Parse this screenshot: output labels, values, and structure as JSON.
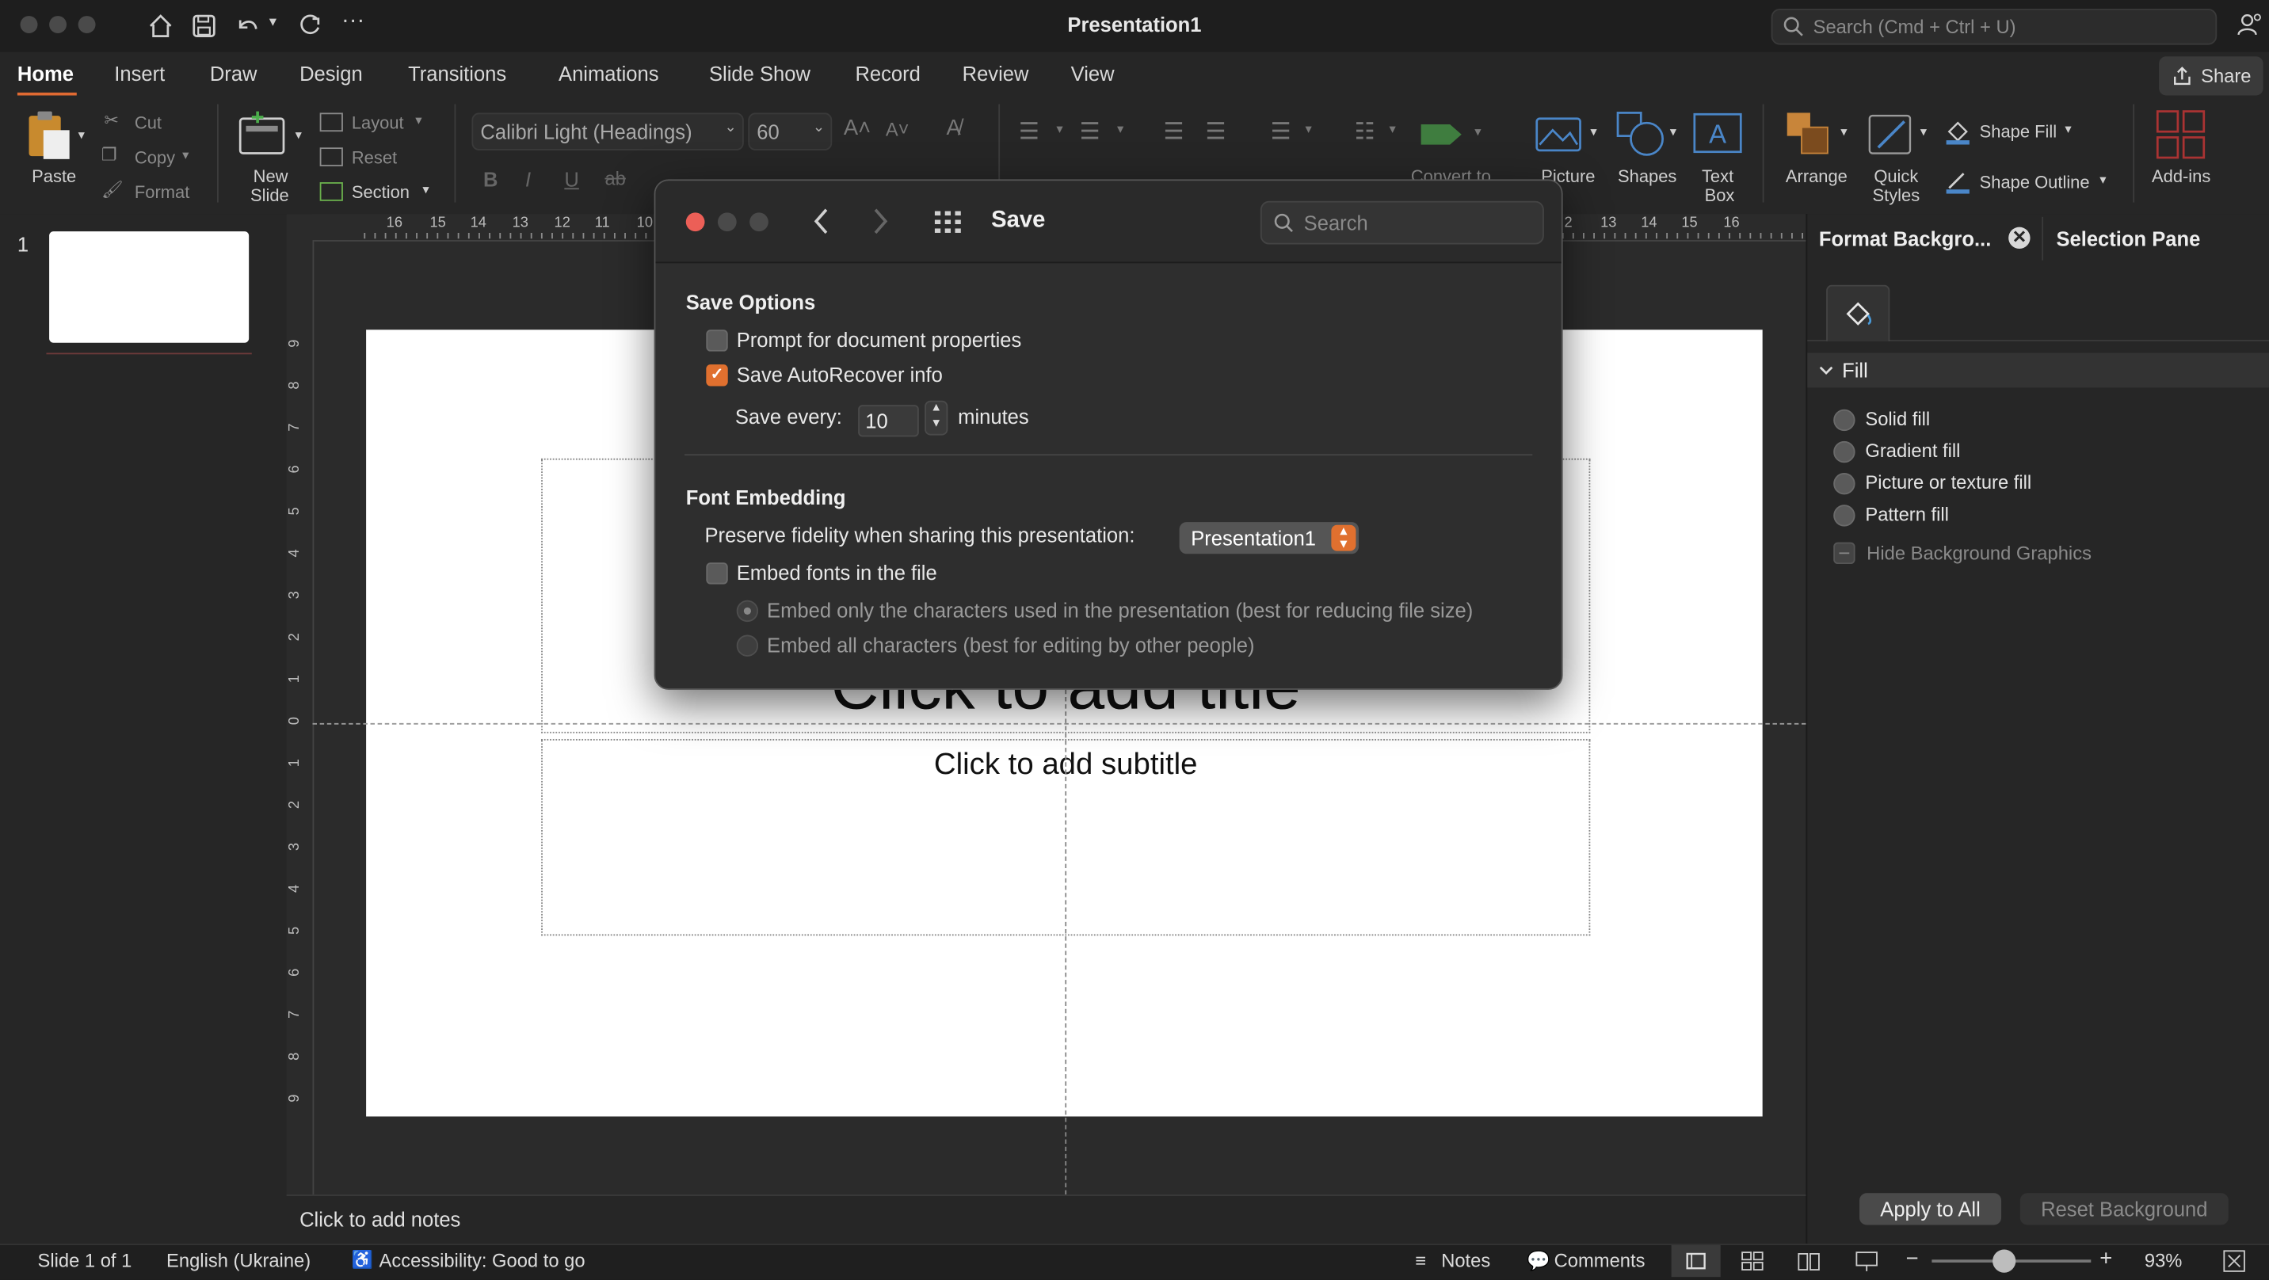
{
  "window": {
    "title": "Presentation1",
    "search_placeholder": "Search (Cmd + Ctrl + U)"
  },
  "tabs": [
    "Home",
    "Insert",
    "Draw",
    "Design",
    "Transitions",
    "Animations",
    "Slide Show",
    "Record",
    "Review",
    "View"
  ],
  "share_label": "Share",
  "ribbon": {
    "paste": "Paste",
    "cut": "Cut",
    "copy": "Copy",
    "format": "Format",
    "new_slide": "New\nSlide",
    "new_slide_l1": "New",
    "new_slide_l2": "Slide",
    "layout": "Layout",
    "reset": "Reset",
    "section": "Section",
    "font_name": "Calibri Light (Headings)",
    "font_size": "60",
    "convert_to": "Convert to",
    "picture": "Picture",
    "shapes": "Shapes",
    "text_box_l1": "Text",
    "text_box_l2": "Box",
    "arrange": "Arrange",
    "quick_styles_l1": "Quick",
    "quick_styles_l2": "Styles",
    "shape_fill": "Shape Fill",
    "shape_outline": "Shape Outline",
    "add_ins": "Add-ins"
  },
  "ruler_labels": [
    "16",
    "15",
    "14",
    "13",
    "12",
    "11",
    "10",
    "2",
    "13",
    "14",
    "15",
    "16"
  ],
  "vruler_labels": [
    "9",
    "8",
    "7",
    "6",
    "5",
    "4",
    "3",
    "2",
    "1",
    "0",
    "1",
    "2",
    "3",
    "4",
    "5",
    "6",
    "7",
    "8",
    "9"
  ],
  "thumbnails": {
    "slide_number": "1"
  },
  "slide": {
    "title_placeholder": "Click to add title",
    "subtitle_placeholder": "Click to add subtitle"
  },
  "notes_placeholder": "Click to add notes",
  "format_pane": {
    "tab_format": "Format Backgro...",
    "tab_selection": "Selection Pane",
    "section": "Fill",
    "options": [
      "Solid fill",
      "Gradient fill",
      "Picture or texture fill",
      "Pattern fill"
    ],
    "hide_bg": "Hide Background Graphics",
    "apply_all": "Apply to All",
    "reset_bg": "Reset Background"
  },
  "dialog": {
    "title": "Save",
    "search_placeholder": "Search",
    "save_options_heading": "Save Options",
    "prompt_props": "Prompt for document properties",
    "prompt_props_checked": false,
    "autorecover": "Save AutoRecover info",
    "autorecover_checked": true,
    "save_every_label": "Save every:",
    "save_every_value": "10",
    "minutes_label": "minutes",
    "font_embedding_heading": "Font Embedding",
    "preserve_label": "Preserve fidelity when sharing this presentation:",
    "preserve_value": "Presentation1",
    "embed_fonts": "Embed fonts in the file",
    "embed_fonts_checked": false,
    "embed_only": "Embed only the characters used in the presentation (best for reducing file size)",
    "embed_all": "Embed all characters (best for editing by other people)"
  },
  "status": {
    "slide_count": "Slide 1 of 1",
    "language": "English (Ukraine)",
    "accessibility": "Accessibility: Good to go",
    "notes": "Notes",
    "comments": "Comments",
    "zoom": "93%"
  },
  "colors": {
    "accent": "#e0702f",
    "close_red": "#ec5f57"
  }
}
